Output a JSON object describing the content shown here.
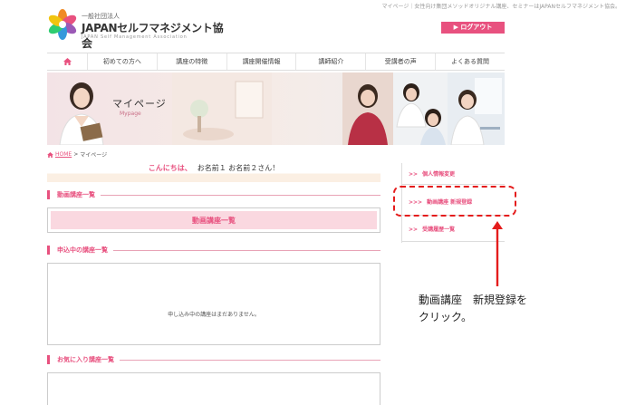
{
  "header": {
    "tagline": "マイページ｜女性向け集団メソッドオリジナル講座、セミナーはJAPANセルフマネジメント協会。",
    "logo_sub": "一般社団法人",
    "logo_main": "JAPANセルフマネジメント協会",
    "logo_en": "JAPAN Self Management Association",
    "logout_label": "▶ ログアウト"
  },
  "nav": {
    "home_icon": "home-icon",
    "items": [
      {
        "label": "初めての方へ"
      },
      {
        "label": "講座の特徴"
      },
      {
        "label": "講座開催情報"
      },
      {
        "label": "講師紹介"
      },
      {
        "label": "受講者の声"
      },
      {
        "label": "よくある質問"
      }
    ]
  },
  "banner": {
    "title": "マイページ",
    "subtitle": "Mypage"
  },
  "breadcrumb": {
    "home": "HOME",
    "separator": ">",
    "current": "マイページ"
  },
  "greeting": {
    "hello": "こんにちは、",
    "name": "お名前１ お名前２さん！"
  },
  "sections": {
    "video": {
      "title": "動画講座一覧",
      "button": "動画講座一覧"
    },
    "applying": {
      "title": "申込中の講座一覧",
      "empty": "申し込み中の講座はまだありません。"
    },
    "favorites": {
      "title": "お気に入り講座一覧"
    }
  },
  "side_menu": {
    "items": [
      {
        "arrow": ">>",
        "label": "個人情報変更"
      },
      {
        "arrow": ">>>",
        "label": "動画講座 新規登録"
      },
      {
        "arrow": ">>",
        "label": "受講履歴一覧"
      }
    ]
  },
  "annotation": {
    "line1": "動画講座　新規登録を",
    "line2": "クリック。"
  },
  "colors": {
    "accent": "#e8517f",
    "highlight": "#e41c1c",
    "pink_light": "#fad8e0"
  }
}
